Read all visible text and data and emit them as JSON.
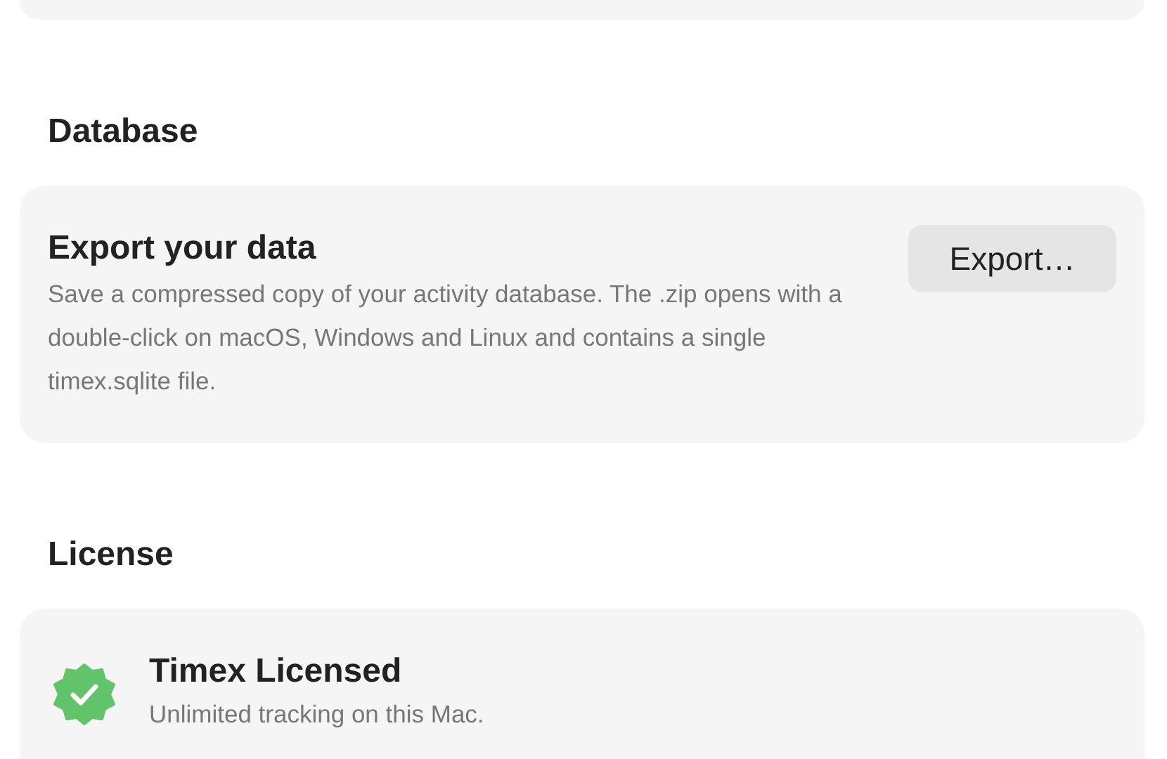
{
  "sections": [
    {
      "kind": "export",
      "heading": "Database",
      "title": "Export your data",
      "description": "Save a compressed copy of your activity database. The .zip opens with a double-click on macOS, Windows and Linux and contains a single timex.sqlite file.",
      "button": "Export…"
    },
    {
      "kind": "license",
      "heading": "License",
      "title": "Timex Licensed",
      "description": "Unlimited tracking on this Mac.",
      "licensed": true
    }
  ]
}
